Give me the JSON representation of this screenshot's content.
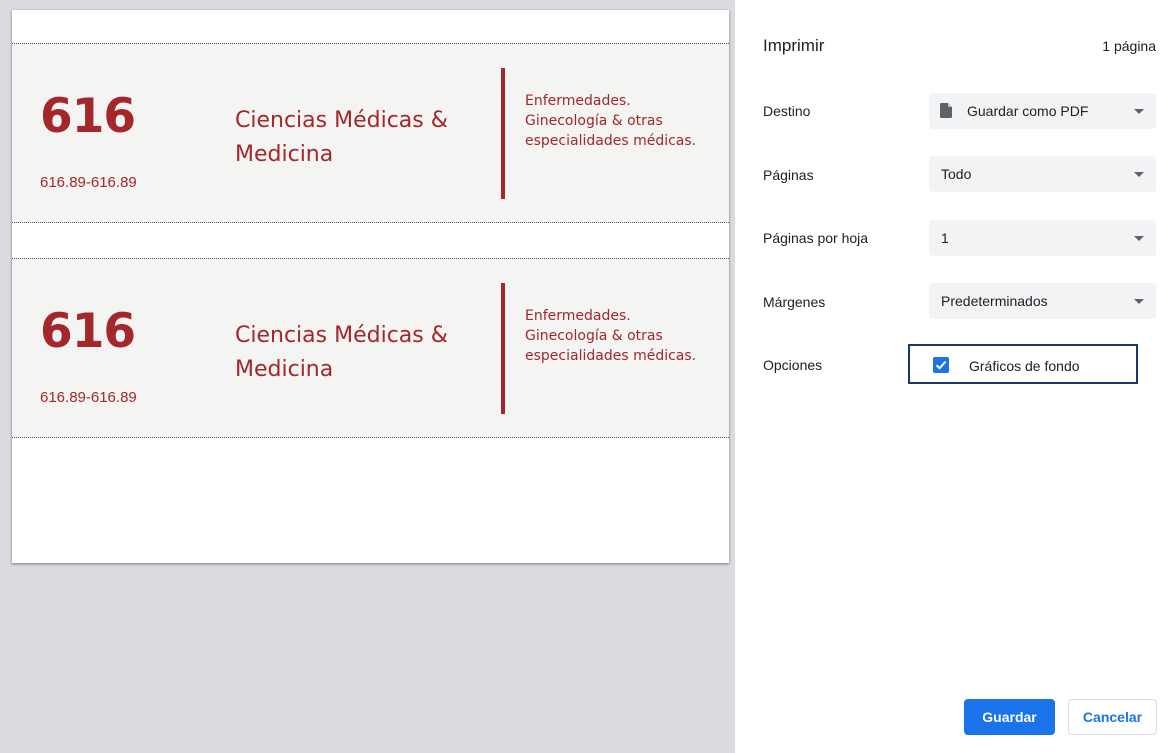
{
  "preview": {
    "labels": [
      {
        "call_number": "616",
        "range": "616.89-616.89",
        "subject": "Ciencias Médicas & Medicina",
        "description": "Enfermedades. Ginecología & otras especialidades médicas."
      },
      {
        "call_number": "616",
        "range": "616.89-616.89",
        "subject": "Ciencias Médicas & Medicina",
        "description": "Enfermedades. Ginecología & otras especialidades médicas."
      }
    ]
  },
  "print": {
    "title": "Imprimir",
    "sheet_count": "1 página",
    "destination": {
      "label": "Destino",
      "value": "Guardar como PDF",
      "icon": "file-icon"
    },
    "pages": {
      "label": "Páginas",
      "value": "Todo"
    },
    "pages_per_sheet": {
      "label": "Páginas por hoja",
      "value": "1"
    },
    "margins": {
      "label": "Márgenes",
      "value": "Predeterminados"
    },
    "options": {
      "label": "Opciones",
      "background_graphics": "Gráficos de fondo",
      "checked": true
    },
    "save_label": "Guardar",
    "cancel_label": "Cancelar"
  },
  "colors": {
    "accent": "#1a73e8",
    "label_red": "#a4272b",
    "card_bg": "#f4f4f2",
    "preview_bg": "#dadce0"
  }
}
